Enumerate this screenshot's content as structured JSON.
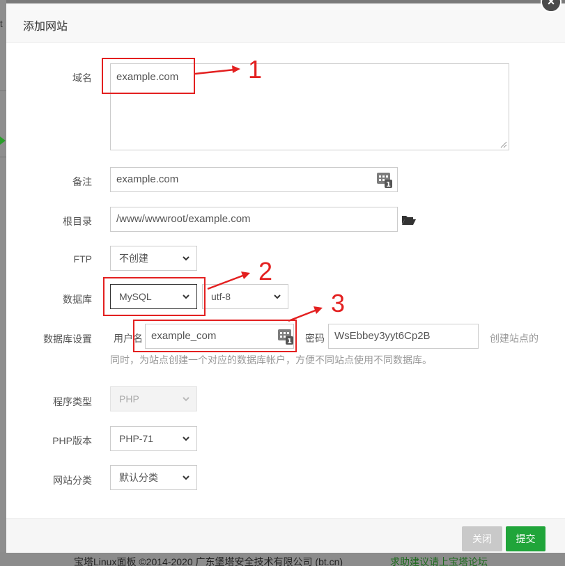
{
  "background": {
    "left_edge_text": "tt",
    "footer_copyright": "宝塔Linux面板 ©2014-2020 广东堡塔安全技术有限公司 (bt.cn)",
    "footer_link": "求助建议请上宝塔论坛"
  },
  "dialog": {
    "title": "添加网站",
    "close_glyph": "×"
  },
  "form": {
    "domain": {
      "label": "域名",
      "value": "example.com"
    },
    "remark": {
      "label": "备注",
      "value": "example.com"
    },
    "root_dir": {
      "label": "根目录",
      "value": "/www/wwwroot/example.com"
    },
    "ftp": {
      "label": "FTP",
      "selected": "不创建"
    },
    "database": {
      "label": "数据库",
      "type_selected": "MySQL",
      "charset_selected": "utf-8"
    },
    "db_settings": {
      "label": "数据库设置",
      "username_label": "用户名",
      "username_value": "example_com",
      "password_label": "密码",
      "password_value": "WsEbbey3yyt6Cp2B",
      "hint_line1": "创建站点的",
      "hint_line2": "同时，为站点创建一个对应的数据库帐户，方便不同站点使用不同数据库。"
    },
    "program_type": {
      "label": "程序类型",
      "selected": "PHP"
    },
    "php_version": {
      "label": "PHP版本",
      "selected": "PHP-71"
    },
    "site_category": {
      "label": "网站分类",
      "selected": "默认分类"
    }
  },
  "buttons": {
    "close": "关闭",
    "submit": "提交"
  },
  "annotations": [
    "1",
    "2",
    "3"
  ],
  "colors": {
    "annotation_red": "#e32020",
    "submit_green": "#20a53a",
    "close_gray": "#c9c9c9"
  }
}
